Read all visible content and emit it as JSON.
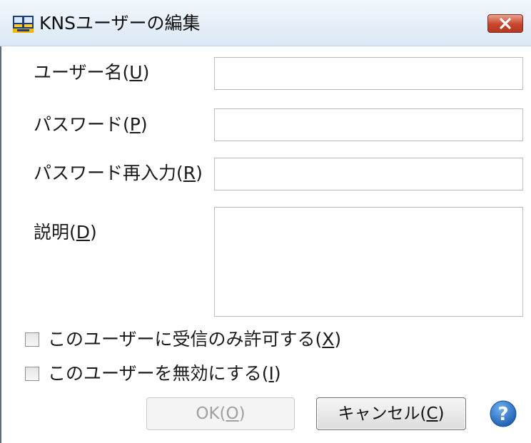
{
  "window": {
    "title": "KNSユーザーの編集",
    "close_glyph": "✕"
  },
  "form": {
    "username": {
      "label": "ユーザー名(",
      "mnemonic": "U",
      "label_end": ")",
      "value": ""
    },
    "password": {
      "label": "パスワード(",
      "mnemonic": "P",
      "label_end": ")",
      "value": ""
    },
    "password_confirm": {
      "label": "パスワード再入力(",
      "mnemonic": "R",
      "label_end": ")",
      "value": ""
    },
    "description": {
      "label": "説明(",
      "mnemonic": "D",
      "label_end": ")",
      "value": ""
    }
  },
  "options": {
    "receive_only": {
      "label": "このユーザーに受信のみ許可する(",
      "mnemonic": "X",
      "label_end": ")",
      "checked": false
    },
    "disable_user": {
      "label": "このユーザーを無効にする(",
      "mnemonic": "I",
      "label_end": ")",
      "checked": false
    }
  },
  "buttons": {
    "ok": {
      "label": "OK(",
      "mnemonic": "O",
      "label_end": ")",
      "enabled": false
    },
    "cancel": {
      "label": "キャンセル(",
      "mnemonic": "C",
      "label_end": ")",
      "enabled": true
    }
  },
  "icons": {
    "app": "app-icon",
    "close": "close-icon",
    "help": "help-icon"
  },
  "colors": {
    "close_red": "#c8452c",
    "help_blue": "#2a74c9",
    "titlebar": "#dbe8f5"
  }
}
